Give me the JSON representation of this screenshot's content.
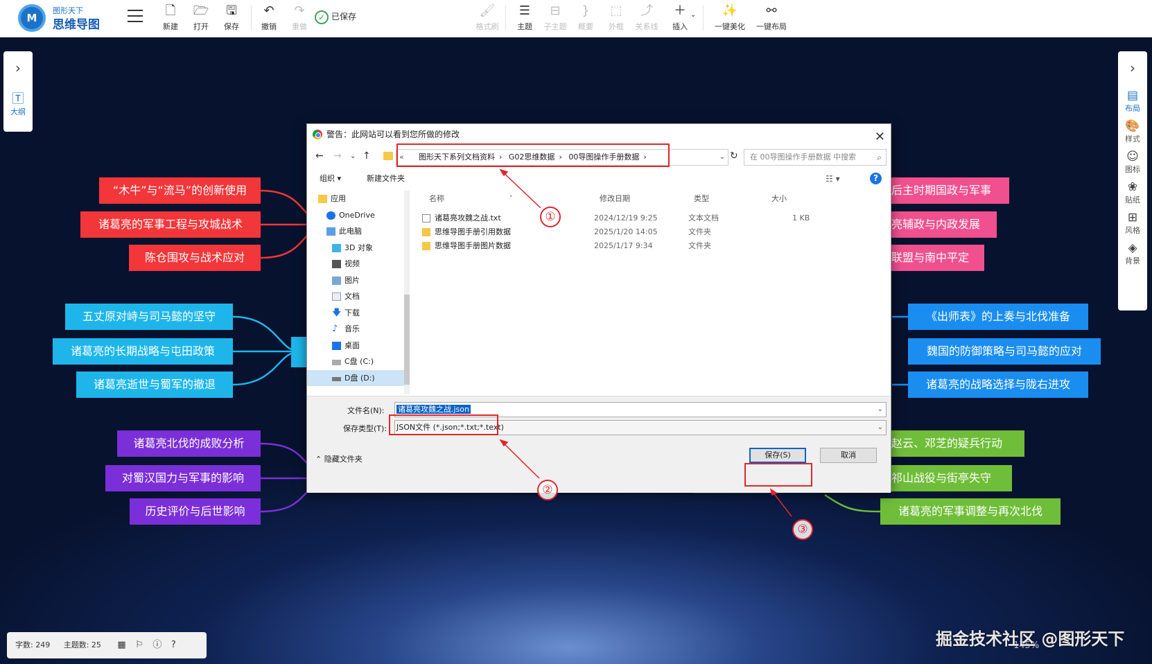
{
  "app": {
    "logo_letters": "M",
    "logo_top": "图形天下",
    "logo_name": "思维导图"
  },
  "toolbar": {
    "items": [
      {
        "key": "new",
        "label": "新建",
        "icon": "new-file-icon"
      },
      {
        "key": "open",
        "label": "打开",
        "icon": "folder-open-icon"
      },
      {
        "key": "save",
        "label": "保存",
        "icon": "save-icon"
      },
      {
        "key": "undo",
        "label": "撤销",
        "icon": "undo-icon"
      },
      {
        "key": "redo",
        "label": "重做",
        "icon": "redo-icon"
      },
      {
        "key": "format_brush",
        "label": "格式刷",
        "icon": "brush-icon"
      },
      {
        "key": "topic",
        "label": "主题",
        "icon": "topic-icon"
      },
      {
        "key": "subtopic",
        "label": "子主题",
        "icon": "subtopic-icon"
      },
      {
        "key": "summary",
        "label": "概要",
        "icon": "summary-icon"
      },
      {
        "key": "frame",
        "label": "外框",
        "icon": "frame-icon"
      },
      {
        "key": "relation",
        "label": "关系线",
        "icon": "relation-icon"
      },
      {
        "key": "insert",
        "label": "插入",
        "icon": "plus-icon"
      },
      {
        "key": "beautify",
        "label": "一键美化",
        "icon": "magic-wand-icon"
      },
      {
        "key": "layout",
        "label": "一键布局",
        "icon": "layout-icon"
      }
    ],
    "saved_status": "已保存"
  },
  "left_panel": {
    "outline_label": "大纲"
  },
  "right_panel": {
    "items": [
      {
        "label": "布局",
        "icon": "layout-panel-icon"
      },
      {
        "label": "样式",
        "icon": "palette-icon"
      },
      {
        "label": "图标",
        "icon": "smiley-icon"
      },
      {
        "label": "贴纸",
        "icon": "sticker-icon"
      },
      {
        "label": "风格",
        "icon": "grid-style-icon"
      },
      {
        "label": "背景",
        "icon": "layers-icon"
      }
    ]
  },
  "nodes": {
    "left_red": [
      "“木牛”与“流马”的创新使用",
      "诸葛亮的军事工程与攻城战术",
      "陈仓围攻与战术应对"
    ],
    "left_cyan": [
      "五丈原对峙与司马懿的坚守",
      "诸葛亮的长期战略与屯田政策",
      "诸葛亮逝世与蜀军的撤退"
    ],
    "left_purple": [
      "诸葛亮北伐的成败分析",
      "对蜀汉国力与军事的影响",
      "历史评价与后世影响"
    ],
    "right_pink": [
      "后主时期国政与军事",
      "亮辅政与内政发展",
      "联盟与南中平定"
    ],
    "right_blue": [
      "《出师表》的上奏与北伐准备",
      "魏国的防御策略与司马懿的应对",
      "诸葛亮的战略选择与陇右进攻"
    ],
    "right_green": [
      "赵云、邓芝的疑兵行动",
      "祁山战役与街亭失守",
      "诸葛亮的军事调整与再次北伐"
    ]
  },
  "status_bar": {
    "word_count": "字数: 249",
    "topic_count": "主题数: 25"
  },
  "watermark": "掘金技术社区 @图形天下",
  "zoom": "145%",
  "dialog": {
    "title": "警告：此网站可以看到您所做的修改",
    "address": [
      "图形天下系列文档资料",
      "G02思维数据",
      "00导图操作手册数据"
    ],
    "search_placeholder": "在 00导图操作手册数据 中搜索",
    "organize": "组织 ▾",
    "new_folder": "新建文件夹",
    "tree": [
      {
        "label": "应用",
        "icon": "folder-icon"
      },
      {
        "label": "OneDrive",
        "icon": "cloud-icon"
      },
      {
        "label": "此电脑",
        "icon": "computer-icon"
      },
      {
        "label": "3D 对象",
        "icon": "cube-icon"
      },
      {
        "label": "视频",
        "icon": "video-icon"
      },
      {
        "label": "图片",
        "icon": "picture-icon"
      },
      {
        "label": "文档",
        "icon": "document-icon"
      },
      {
        "label": "下载",
        "icon": "download-icon"
      },
      {
        "label": "音乐",
        "icon": "music-icon"
      },
      {
        "label": "桌面",
        "icon": "desktop-icon"
      },
      {
        "label": "C盘 (C:)",
        "icon": "drive-icon"
      },
      {
        "label": "D盘 (D:)",
        "icon": "drive-icon"
      }
    ],
    "columns": {
      "name": "名称",
      "date": "修改日期",
      "type": "类型",
      "size": "大小"
    },
    "files": [
      {
        "name": "诸葛亮攻魏之战.txt",
        "date": "2024/12/19 9:25",
        "type": "文本文档",
        "size": "1 KB",
        "icon": "text-file-icon"
      },
      {
        "name": "思维导图手册引用数据",
        "date": "2025/1/20 14:05",
        "type": "文件夹",
        "size": "",
        "icon": "folder-icon"
      },
      {
        "name": "思维导图手册图片数据",
        "date": "2025/1/17 9:34",
        "type": "文件夹",
        "size": "",
        "icon": "folder-icon"
      }
    ],
    "filename_label": "文件名(N):",
    "filename_value": "诸葛亮攻魏之战.json",
    "filetype_label": "保存类型(T):",
    "filetype_value": "JSON文件 (*.json;*.txt;*.text)",
    "hide_folders": "隐藏文件夹",
    "save_button": "保存(S)",
    "cancel_button": "取消"
  },
  "annotations": [
    "①",
    "②",
    "③"
  ]
}
